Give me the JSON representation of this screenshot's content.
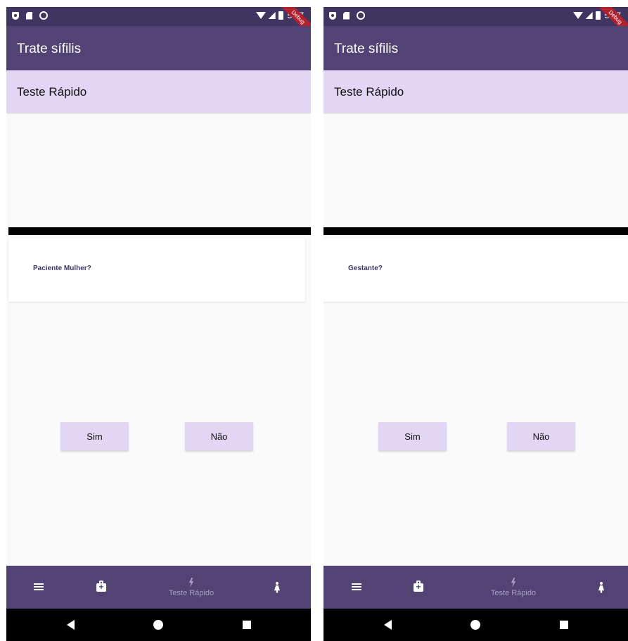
{
  "screens": [
    {
      "status_bar": {
        "time": "5:47",
        "icons": [
          "shield-icon",
          "sd-card-icon",
          "sync-ring-icon",
          "wifi-icon",
          "signal-icon",
          "battery-icon"
        ]
      },
      "debug_banner": "Debug",
      "app_bar": {
        "title": "Trate sífilis"
      },
      "subheader": {
        "title": "Teste Rápido"
      },
      "question": "Paciente Mulher?",
      "buttons": {
        "yes": "Sim",
        "no": "Não"
      },
      "bottom_nav": {
        "items": [
          {
            "icon": "menu-icon",
            "label": ""
          },
          {
            "icon": "medical-kit-icon",
            "label": ""
          },
          {
            "icon": "bolt-icon",
            "label": "Teste Rápido",
            "active": true
          },
          {
            "icon": "woman-icon",
            "label": ""
          }
        ]
      }
    },
    {
      "status_bar": {
        "time": "5:47",
        "icons": [
          "shield-icon",
          "sd-card-icon",
          "sync-ring-icon",
          "wifi-icon",
          "signal-icon",
          "battery-icon"
        ]
      },
      "debug_banner": "Debug",
      "app_bar": {
        "title": "Trate sífilis"
      },
      "subheader": {
        "title": "Teste Rápido"
      },
      "question": "Gestante?",
      "buttons": {
        "yes": "Sim",
        "no": "Não"
      },
      "bottom_nav": {
        "items": [
          {
            "icon": "menu-icon",
            "label": ""
          },
          {
            "icon": "medical-kit-icon",
            "label": ""
          },
          {
            "icon": "bolt-icon",
            "label": "Teste Rápido",
            "active": true
          },
          {
            "icon": "woman-icon",
            "label": ""
          }
        ]
      }
    }
  ],
  "colors": {
    "status_bar": "#3f3560",
    "app_bar": "#514474",
    "subheader": "#e1d6f4",
    "question_text": "#3e3766",
    "debug_ribbon": "#b3202e",
    "nav_inactive_label": "#a99fc4"
  }
}
